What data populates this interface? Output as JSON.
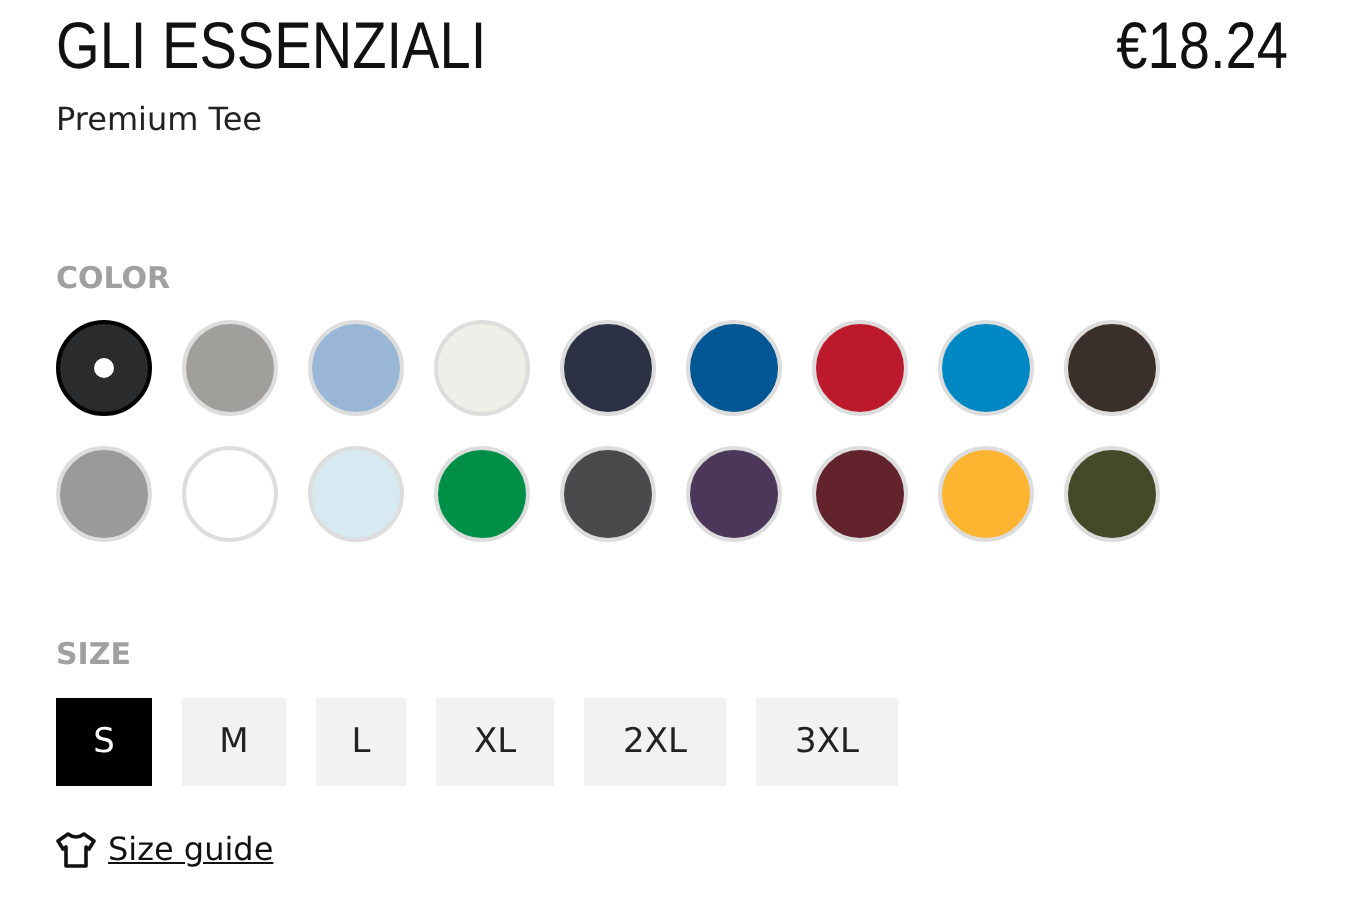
{
  "product": {
    "brand": "GLI ESSENZIALI",
    "price": "€18.24",
    "name": "Premium Tee"
  },
  "color": {
    "label": "COLOR",
    "swatches": [
      {
        "color": "#2a2b2d",
        "selected": true
      },
      {
        "color": "#a09f9b",
        "selected": false
      },
      {
        "color": "#9ab6d6",
        "selected": false
      },
      {
        "color": "#efefea",
        "selected": false
      },
      {
        "color": "#2b3044",
        "selected": false
      },
      {
        "color": "#005793",
        "selected": false
      },
      {
        "color": "#bd192d",
        "selected": false
      },
      {
        "color": "#0088c4",
        "selected": false
      },
      {
        "color": "#3b2f2c",
        "selected": false
      },
      {
        "color": "#9a9a9b",
        "selected": false
      },
      {
        "color": "#ffffff",
        "selected": false
      },
      {
        "color": "#d8eaf1",
        "selected": false
      },
      {
        "color": "#008f46",
        "selected": false
      },
      {
        "color": "#4a4a4c",
        "selected": false
      },
      {
        "color": "#4b3759",
        "selected": false
      },
      {
        "color": "#63232c",
        "selected": false
      },
      {
        "color": "#fdb431",
        "selected": false
      },
      {
        "color": "#434929",
        "selected": false
      }
    ]
  },
  "size": {
    "label": "SIZE",
    "options": [
      {
        "label": "S",
        "selected": true
      },
      {
        "label": "M",
        "selected": false
      },
      {
        "label": "L",
        "selected": false
      },
      {
        "label": "XL",
        "selected": false
      },
      {
        "label": "2XL",
        "selected": false
      },
      {
        "label": "3XL",
        "selected": false
      }
    ],
    "guide_link": "Size guide"
  }
}
